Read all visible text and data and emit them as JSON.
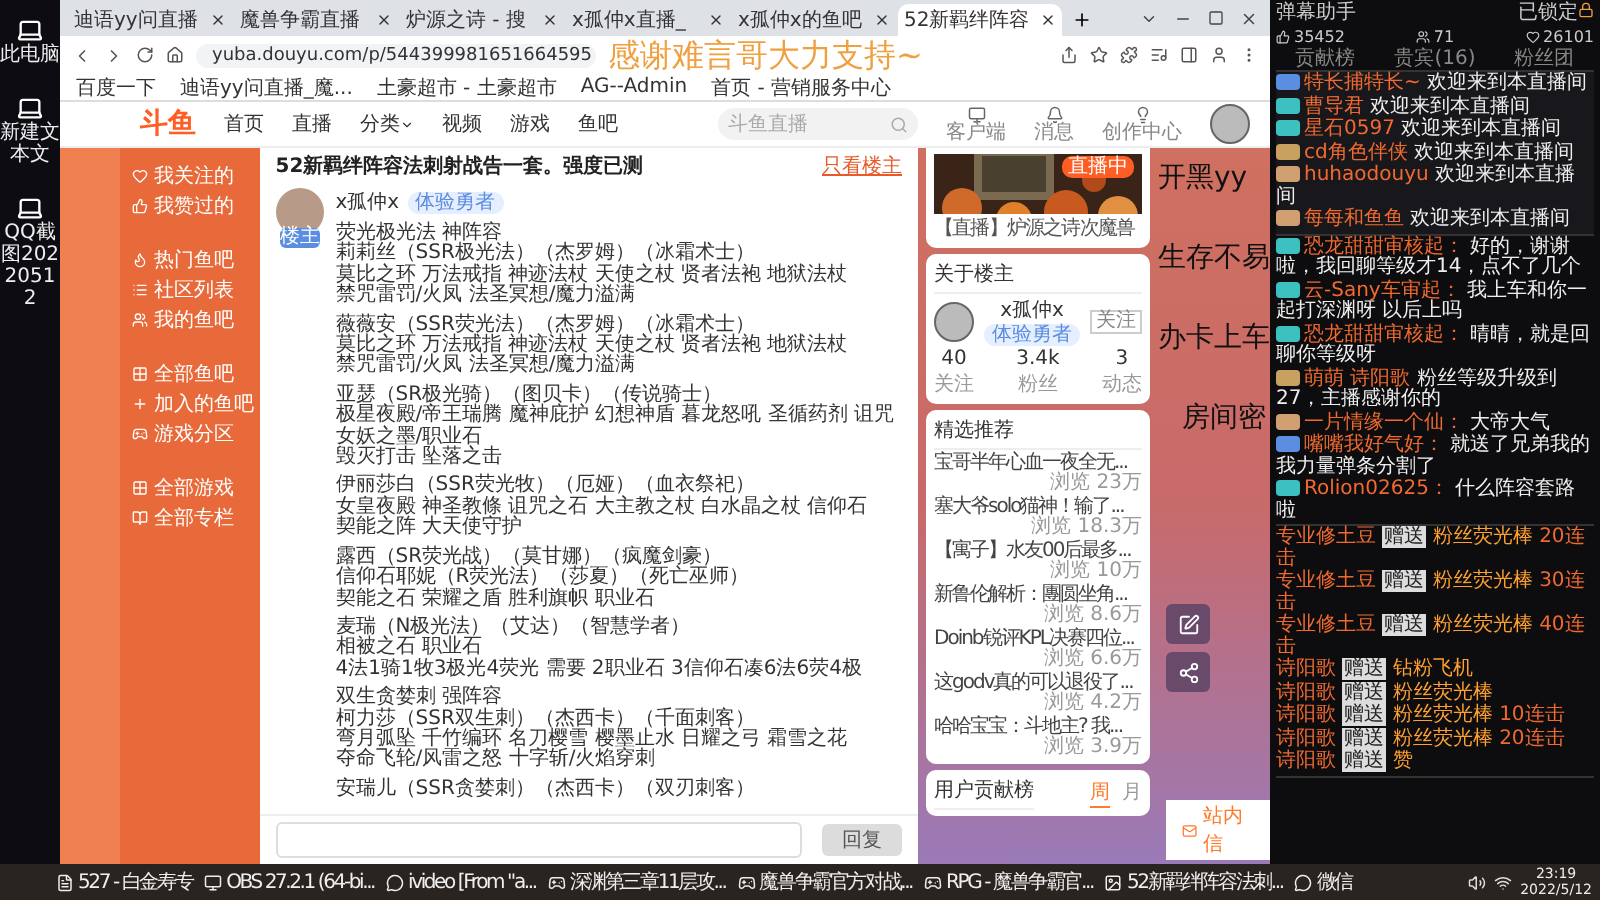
{
  "desktop_icons": [
    {
      "label": "此电脑"
    },
    {
      "label": "新建文本文"
    },
    {
      "label": "QQ截图20220512"
    }
  ],
  "browser": {
    "tabs": [
      {
        "title": "迪语yy问直播",
        "selected": false
      },
      {
        "title": "魔兽争霸直播",
        "selected": false
      },
      {
        "title": "炉源之诗 - 搜",
        "selected": false
      },
      {
        "title": "x孤仲x直播_",
        "selected": false
      },
      {
        "title": "x孤仲x的鱼吧",
        "selected": false
      },
      {
        "title": "52新羁绊阵容",
        "selected": true
      }
    ],
    "url": "yuba.douyu.com/p/544399981651664595",
    "bookmarks": [
      "百度一下",
      "迪语yy问直播_魔...",
      "土豪超市 - 土豪超市",
      "AG--Admin",
      "首页 - 营销服务中心"
    ]
  },
  "overlay": {
    "thanks": "感谢难言哥大力支持~",
    "side_texts": [
      "开黑yy",
      "生存不易",
      "办卡上车",
      "房间密"
    ]
  },
  "site": {
    "logo": "斗鱼",
    "nav": [
      "首页",
      "直播",
      "分类",
      "视频",
      "游戏",
      "鱼吧"
    ],
    "search_placeholder": "斗鱼直播",
    "header_icons": [
      "客户端",
      "消息",
      "创作中心"
    ]
  },
  "sidebar": [
    {
      "label": "我关注的"
    },
    {
      "label": "我赞过的"
    },
    {
      "label": "热门鱼吧"
    },
    {
      "label": "社区列表"
    },
    {
      "label": "我的鱼吧"
    },
    {
      "label": "全部鱼吧"
    },
    {
      "label": "加入的鱼吧"
    },
    {
      "label": "游戏分区"
    },
    {
      "label": "全部游戏"
    },
    {
      "label": "全部专栏"
    }
  ],
  "post": {
    "title": "52新羁绊阵容法刺射战告一套。强度已测",
    "only_op": "只看楼主",
    "author": {
      "name": "x孤仲x",
      "badge": "体验勇者",
      "role": "楼主"
    },
    "paragraphs": [
      [
        "荧光极光法 神阵容",
        "莉莉丝（SSR极光法）（杰罗姆）（冰霜术士）",
        "莫比之环 万法戒指 神迹法杖 天使之杖 贤者法袍 地狱法杖",
        "禁咒雷罚/火凤 法圣冥想/魔力溢满"
      ],
      [
        "薇薇安（SSR荧光法）（杰罗姆）（冰霜术士）",
        "莫比之环 万法戒指 神迹法杖 天使之杖 贤者法袍 地狱法杖",
        "禁咒雷罚/火凤 法圣冥想/魔力溢满"
      ],
      [
        "亚瑟（SR极光骑）（图贝卡）（传说骑士）",
        "极星夜殿/帝王瑞腾 魔神庇护 幻想神盾 暮龙怒吼 圣循药剂 诅咒女妖之墨/职业石",
        "毁灭打击 坠落之击"
      ],
      [
        "伊丽莎白（SSR荧光牧）（厄娅）（血衣祭祀）",
        "女皇夜殿 神圣教條 诅咒之石 大主教之杖 白水晶之杖 信仰石",
        "契能之阵 大天使守护"
      ],
      [
        "露西（SR荧光战）（莫甘娜）（疯魔剑豪）",
        "信仰石耶妮（R荧光法）（莎夏）（死亡巫师）",
        "契能之石 荣耀之盾 胜利旗帜 职业石"
      ],
      [
        "麦瑞（N极光法）（艾达）（智慧学者）",
        "相被之石 职业石",
        "4法1骑1牧3极光4荧光 需要 2职业石 3信仰石凑6法6荧4极"
      ],
      [
        "双生贪婪刺 强阵容",
        "柯力莎（SSR双生刺）（杰西卡）（千面刺客）",
        "弯月弧坠 千竹编环 名刀樱雪 樱墨止水 日耀之弓 霜雪之花",
        "夺命飞轮/风雷之怒 十字斩/火焰穿刺"
      ],
      [
        "安瑞儿（SSR贪婪刺）（杰西卡）（双刃刺客）"
      ]
    ],
    "reply_button": "回复"
  },
  "right": {
    "stream": {
      "badge": "直播中",
      "caption": "【直播】炉源之诗次魔兽"
    },
    "about": {
      "title": "关于楼主",
      "name": "x孤仲x",
      "badge": "体验勇者",
      "follow": "关注",
      "stats": [
        {
          "value": "40",
          "label": "关注"
        },
        {
          "value": "3.4k",
          "label": "粉丝"
        },
        {
          "value": "3",
          "label": "动态"
        }
      ]
    },
    "picks": {
      "title": "精选推荐",
      "items": [
        {
          "title": "宝哥半年心血一夜全无...",
          "views": "浏览 23万"
        },
        {
          "title": "塞大爷solo猫神！输了...",
          "views": "浏览 18.3万"
        },
        {
          "title": "【寓子】水友00后最多...",
          "views": "浏览 10万"
        },
        {
          "title": "新鲁伦解析：團圆坐角...",
          "views": "浏览 8.6万"
        },
        {
          "title": "Doinb锐评KPL决赛四位...",
          "views": "浏览 6.6万"
        },
        {
          "title": "这godv真的可以退役了...",
          "views": "浏览 4.2万"
        },
        {
          "title": "哈哈宝宝：斗地主? 我...",
          "views": "浏览 3.9万"
        }
      ]
    },
    "contrib": {
      "title": "用户贡献榜",
      "tabs": [
        {
          "label": "周",
          "selected": true
        },
        {
          "label": "月",
          "selected": false
        }
      ]
    },
    "mail": "站内信"
  },
  "chat": {
    "title": "弹幕助手",
    "lock": "已锁定",
    "stats": [
      "35452",
      "71",
      "26101"
    ],
    "columns": [
      "贡献榜",
      "贵宾(16)",
      "粉丝团"
    ],
    "welcomes": [
      {
        "name": "特长捕特长~",
        "text": "欢迎来到本直播间",
        "color": "#5b8de0"
      },
      {
        "name": "曹导君",
        "text": "欢迎来到本直播间",
        "color": "#3cc0c0"
      },
      {
        "name": "星石0597",
        "text": "欢迎来到本直播间",
        "color": "#3cc0c0"
      },
      {
        "name": "cd角色伴侠",
        "text": "欢迎来到本直播间",
        "color": "#c8a060"
      },
      {
        "name": "huhaodouyu",
        "text": "欢迎来到本直播间",
        "color": "#d0a070"
      },
      {
        "name": "每每和鱼鱼",
        "text": "欢迎来到本直播间",
        "color": "#d0a070"
      }
    ],
    "messages": [
      {
        "name": "恐龙甜甜审核起：",
        "text": "好的，谢谢啦，我回聊等级才14，点不了几个",
        "color": "#3cc0c0"
      },
      {
        "name": "云-Sany车审起：",
        "text": "我上车和你一起打深渊呀 以后上吗",
        "color": "#3cc0c0"
      },
      {
        "name": "恐龙甜甜审核起：",
        "text": "晴晴，就是回聊你等级呀",
        "color": "#3cc0c0"
      },
      {
        "name": "萌萌 诗阳歌",
        "text": "粉丝等级升级到 27，主播感谢你的",
        "color": "#c8a060"
      },
      {
        "name": "一片情缘一个仙：",
        "text": "大帝大气",
        "color": "#d0a070"
      },
      {
        "name": "嘴嘴我好气好：",
        "text": "就送了兄弟我的我力量弹条分割了",
        "color": "#5b8de0"
      },
      {
        "name": "Rolion02625：",
        "text": "什么阵容套路啦",
        "color": "#3cc0c0"
      }
    ],
    "gifts": [
      {
        "name": "专业修土豆",
        "verb": "赠送",
        "gift": "粉丝荧光棒",
        "combo": "20连击"
      },
      {
        "name": "专业修土豆",
        "verb": "赠送",
        "gift": "粉丝荧光棒",
        "combo": "30连击"
      },
      {
        "name": "专业修土豆",
        "verb": "赠送",
        "gift": "粉丝荧光棒",
        "combo": "40连击"
      },
      {
        "name": "诗阳歌",
        "verb": "赠送",
        "gift": "钻粉飞机"
      },
      {
        "name": "诗阳歌",
        "verb": "赠送",
        "gift": "粉丝荧光棒"
      },
      {
        "name": "诗阳歌",
        "verb": "赠送",
        "gift": "粉丝荧光棒",
        "combo": "10连击"
      },
      {
        "name": "诗阳歌",
        "verb": "赠送",
        "gift": "粉丝荧光棒",
        "combo": "20连击"
      },
      {
        "name": "诗阳歌",
        "verb": "赠送",
        "gift": "赞"
      }
    ]
  },
  "taskbar": {
    "items": [
      {
        "label": "527 - 白金寿专"
      },
      {
        "label": "OBS 27.2.1 (64-bi..."
      },
      {
        "label": "ivideo [From \"a..."
      },
      {
        "label": "深渊第三章11层攻..."
      },
      {
        "label": "魔兽争霸官方对战..."
      },
      {
        "label": "RPG - 魔兽争霸官..."
      },
      {
        "label": "52新羁绊阵容法刺..."
      },
      {
        "label": "微信"
      }
    ],
    "time": "23:19",
    "date": "2022/5/12"
  }
}
